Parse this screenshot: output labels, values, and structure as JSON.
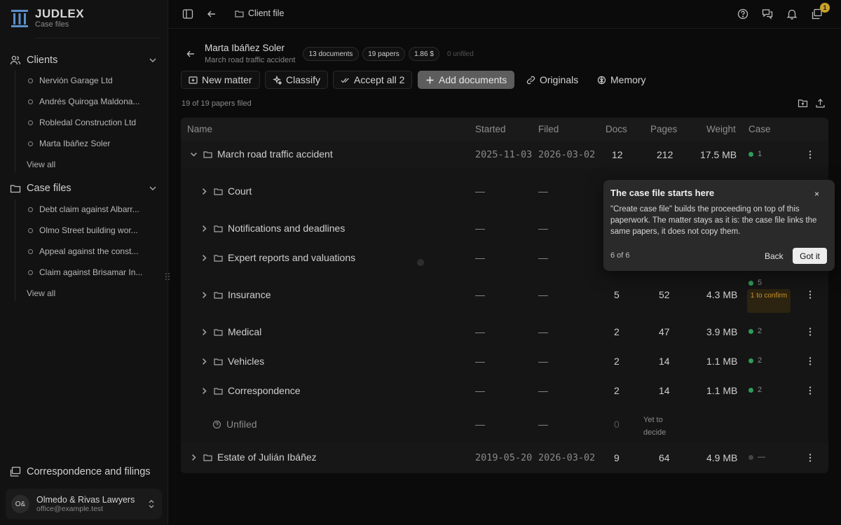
{
  "brand": {
    "name": "JUDLEX",
    "subtitle": "Case files"
  },
  "sidebar": {
    "clients": {
      "label": "Clients",
      "items": [
        "Nervión Garage Ltd",
        "Andrés Quiroga Maldona...",
        "Robledal Construction Ltd",
        "Marta Ibáñez Soler"
      ],
      "view_all": "View all"
    },
    "case_files": {
      "label": "Case files",
      "items": [
        "Debt claim against Albarr...",
        "Olmo Street building wor...",
        "Appeal against the const...",
        "Claim against Brisamar In..."
      ],
      "view_all": "View all"
    },
    "correspondence": "Correspondence and filings",
    "account": {
      "initials": "O&",
      "name": "Olmedo & Rivas Lawyers",
      "email": "office@example.test"
    }
  },
  "topbar": {
    "breadcrumb": "Client file",
    "notification_count": "1"
  },
  "header": {
    "client_name": "Marta Ibáñez Soler",
    "client_subtitle": "March road traffic accident",
    "pills": [
      "13 documents",
      "19 papers",
      "1.86 $"
    ],
    "unfiled": "0 unfiled"
  },
  "toolbar": {
    "new_matter": "New matter",
    "classify": "Classify",
    "accept_all": "Accept all 2",
    "add_documents": "Add documents",
    "originals": "Originals",
    "memory": "Memory"
  },
  "filed_count": "19 of 19 papers filed",
  "table": {
    "columns": {
      "name": "Name",
      "started": "Started",
      "filed": "Filed",
      "docs": "Docs",
      "pages": "Pages",
      "weight": "Weight",
      "case": "Case"
    },
    "dash": "—",
    "rows": [
      {
        "name": "March road traffic accident",
        "started": "2025-11-03",
        "filed": "2026-03-02",
        "docs": "12",
        "pages": "212",
        "weight": "17.5 MB",
        "case": "1"
      },
      {
        "name": "Court"
      },
      {
        "name": "Notifications and deadlines"
      },
      {
        "name": "Expert reports and valuations"
      },
      {
        "name": "Insurance",
        "docs": "5",
        "pages": "52",
        "weight": "4.3 MB",
        "case": "5",
        "confirm": "1 to confirm"
      },
      {
        "name": "Medical",
        "docs": "2",
        "pages": "47",
        "weight": "3.9 MB",
        "case": "2"
      },
      {
        "name": "Vehicles",
        "docs": "2",
        "pages": "14",
        "weight": "1.1 MB",
        "case": "2"
      },
      {
        "name": "Correspondence",
        "docs": "2",
        "pages": "14",
        "weight": "1.1 MB",
        "case": "2"
      },
      {
        "name": "Unfiled",
        "docs": "0",
        "decide": "Yet to decide"
      },
      {
        "name": "Estate of Julián Ibáñez",
        "started": "2019-05-20",
        "filed": "2026-03-02",
        "docs": "9",
        "pages": "64",
        "weight": "4.9 MB",
        "case": "—"
      }
    ]
  },
  "popover": {
    "title": "The case file starts here",
    "close": "×",
    "body": "\"Create case file\" builds the proceeding on top of this paperwork. The matter stays as it is: the case file links the same papers, it does not copy them.",
    "step": "6 of 6",
    "back": "Back",
    "got_it": "Got it"
  },
  "colors": {
    "accent_green": "#2e9d57",
    "warning": "#c9952b",
    "primary_button": "#5d5d5d"
  }
}
